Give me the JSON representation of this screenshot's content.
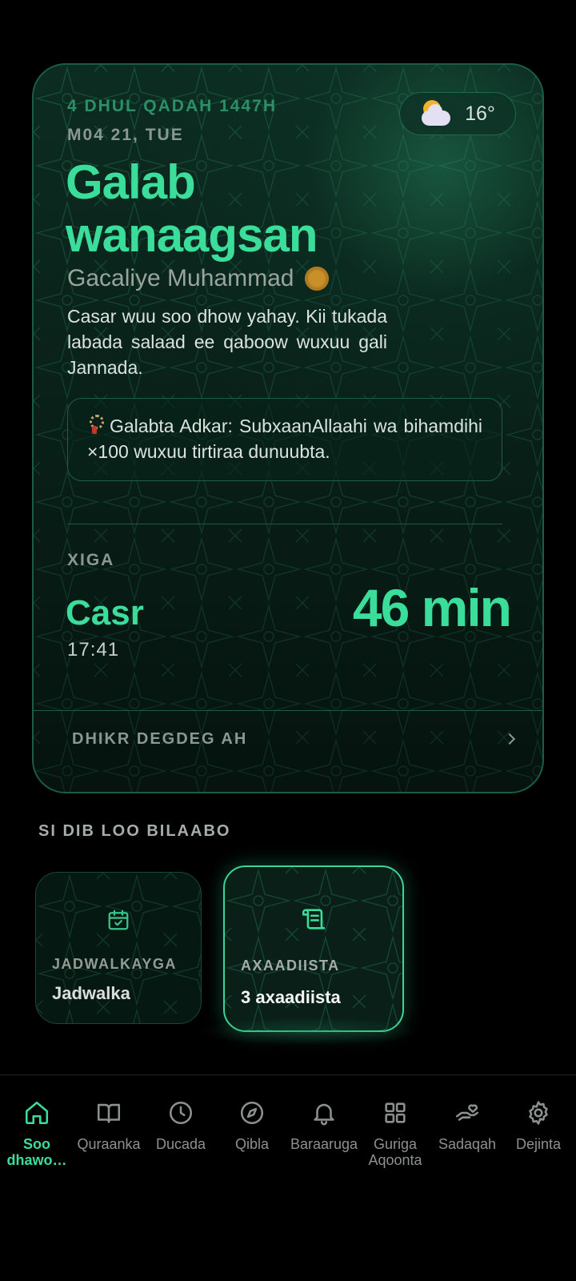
{
  "hero": {
    "hijri_date": "4 DHUL QADAH 1447H",
    "gregorian_date": "M04 21, TUE",
    "greeting_line1": "Galab",
    "greeting_line2": "wanaagsan",
    "user_name": "Gacaliye Muhammad",
    "message": "Casar wuu soo dhow yahay. Kii tukada labada salaad ee qaboow wuxuu gali Jannada.",
    "weather": {
      "icon": "partly-cloudy-icon",
      "temperature": "16°"
    },
    "adkar": "Galabta Adkar: SubxaanAllaahi wa bihamdihi ×100 wuxuu tirtiraa dunuubta.",
    "next_label": "XIGA",
    "next_prayer": "Casr",
    "next_time": "17:41",
    "countdown": "46 min",
    "quick_dhikr": "DHIKR DEGDEG AH"
  },
  "continue": {
    "title": "SI DIB LOO BILAABO",
    "cards": [
      {
        "icon": "calendar-check-icon",
        "label": "JADWALKAYGA",
        "value": "Jadwalka"
      },
      {
        "icon": "scroll-icon",
        "label": "AXAADIISTA",
        "value": "3 axaadiista"
      }
    ]
  },
  "nav": {
    "items": [
      {
        "icon": "home-icon",
        "label": "Soo dhawo…",
        "active": true
      },
      {
        "icon": "book-icon",
        "label": "Quraanka"
      },
      {
        "icon": "clock-icon",
        "label": "Ducada"
      },
      {
        "icon": "compass-icon",
        "label": "Qibla"
      },
      {
        "icon": "bell-icon",
        "label": "Baraaruga"
      },
      {
        "icon": "grid-icon",
        "label": "Guriga Aqoonta"
      },
      {
        "icon": "hand-heart-icon",
        "label": "Sadaqah"
      },
      {
        "icon": "gear-icon",
        "label": "Dejinta"
      }
    ]
  },
  "colors": {
    "accent": "#3bdd9b",
    "background": "#000000",
    "card": "#0c2a20"
  }
}
